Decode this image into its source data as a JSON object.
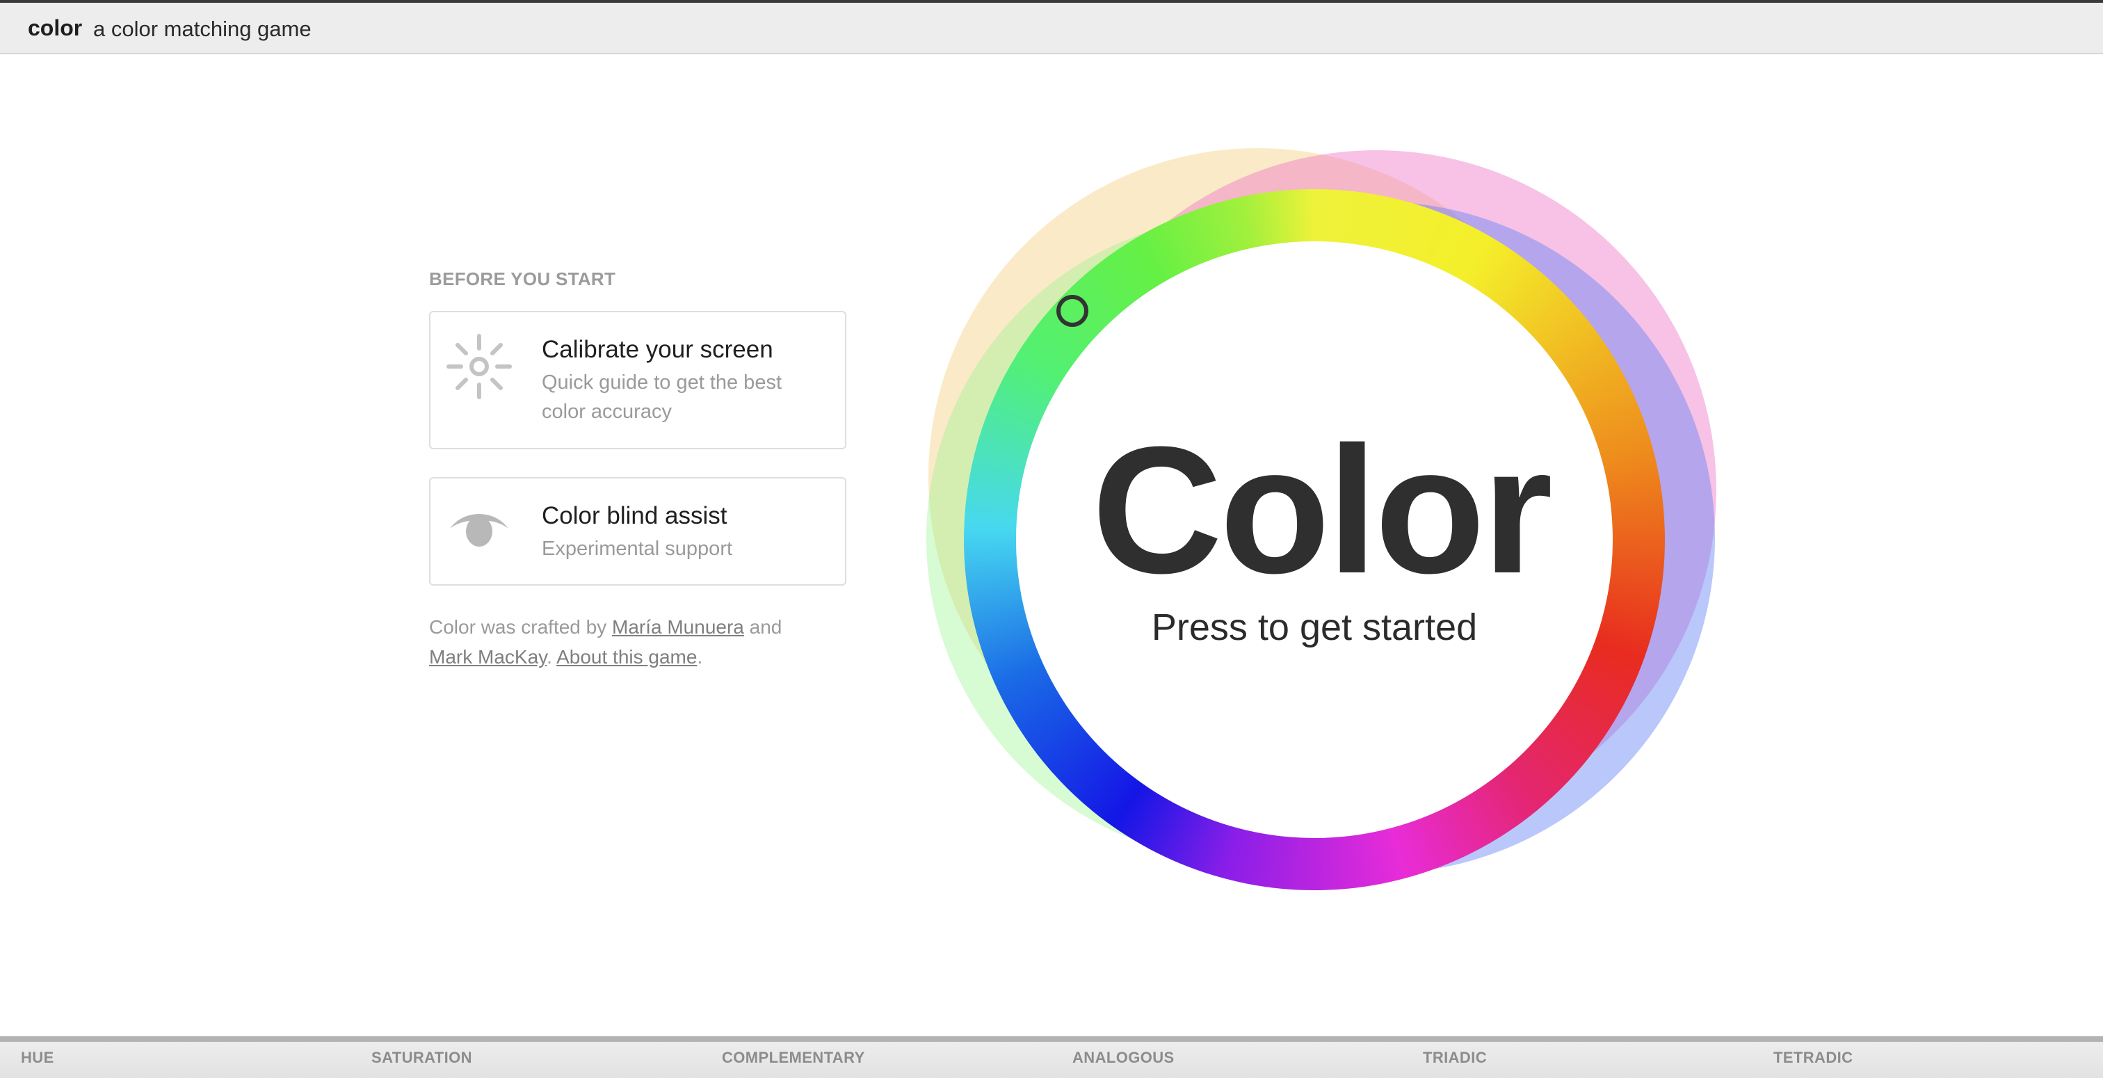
{
  "header": {
    "brand": "color",
    "tagline": "a color matching game"
  },
  "intro": {
    "heading": "BEFORE YOU START",
    "cards": [
      {
        "title": "Calibrate your screen",
        "description": "Quick guide to get the best color accuracy",
        "icon": "sun-brightness-icon"
      },
      {
        "title": "Color blind assist",
        "description": "Experimental support",
        "icon": "eye-icon"
      }
    ],
    "credits": {
      "prefix": "Color was crafted by ",
      "author1": "María Munuera",
      "joiner": " and ",
      "author2": "Mark MacKay",
      "separator": ". ",
      "about_link": "About this game",
      "suffix": "."
    }
  },
  "wheel": {
    "title": "Color",
    "subtitle": "Press to get started"
  },
  "footer_nav": {
    "items": [
      "HUE",
      "SATURATION",
      "COMPLEMENTARY",
      "ANALOGOUS",
      "TRIADIC",
      "TETRADIC"
    ]
  },
  "colors": {
    "header_bg": "#ededed",
    "muted_text": "#9a9a9a",
    "title_text": "#2f2f2f"
  }
}
